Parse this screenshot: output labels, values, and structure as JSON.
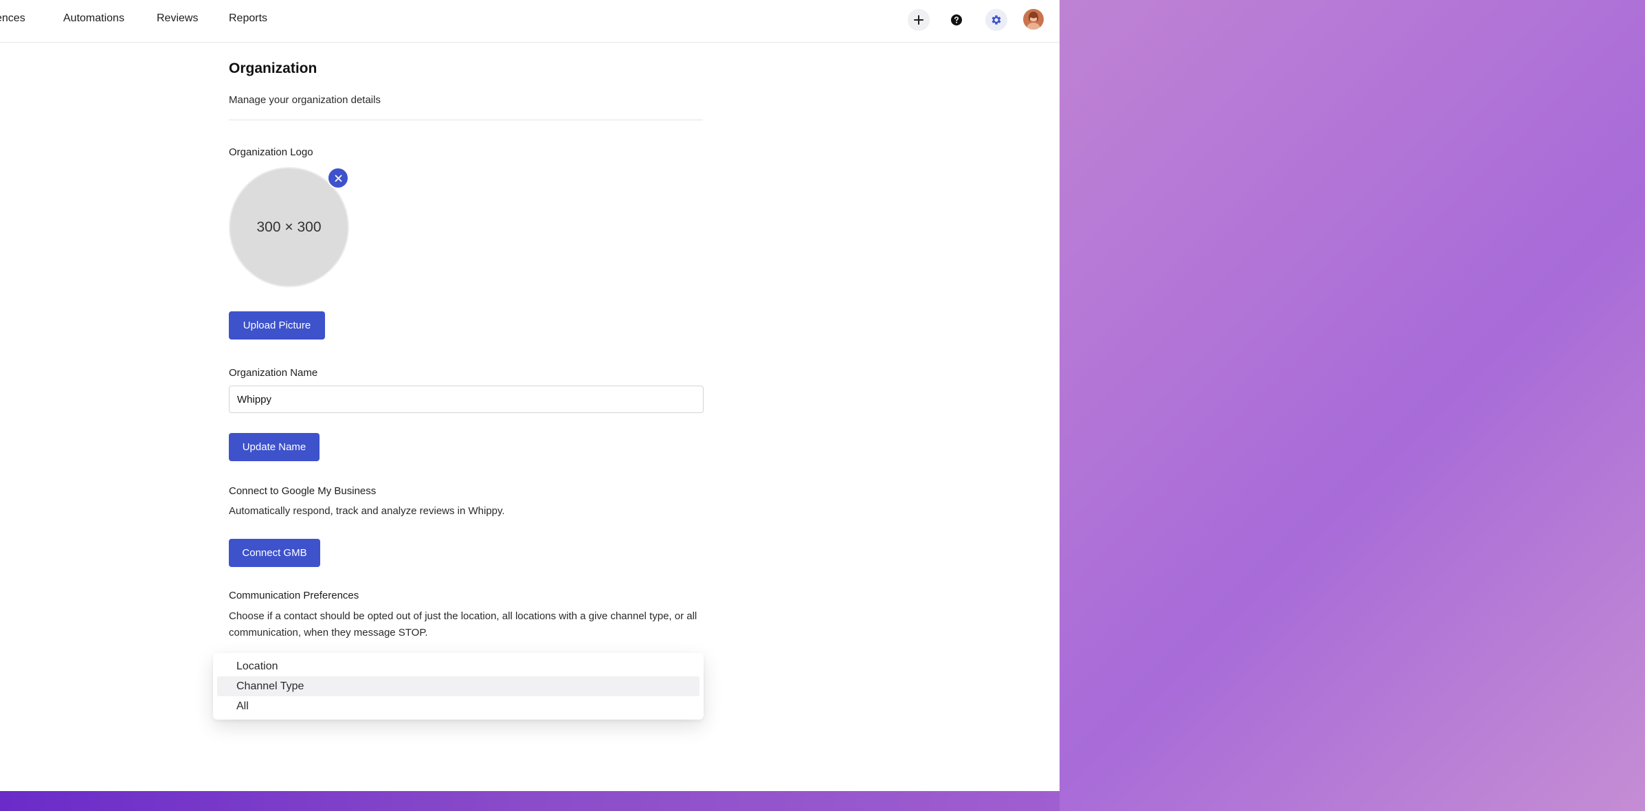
{
  "nav": {
    "items": [
      {
        "label": "ences"
      },
      {
        "label": "Automations"
      },
      {
        "label": "Reviews"
      },
      {
        "label": "Reports"
      }
    ],
    "icons": {
      "add": "plus-icon",
      "help": "help-icon",
      "settings": "gear-icon",
      "avatar": "user-avatar"
    }
  },
  "page": {
    "title": "Organization",
    "subtitle": "Manage your organization details"
  },
  "logo": {
    "label": "Organization Logo",
    "placeholder_text": "300 × 300",
    "upload_label": "Upload Picture"
  },
  "name": {
    "label": "Organization Name",
    "value": "Whippy",
    "update_label": "Update Name"
  },
  "gmb": {
    "label": "Connect to Google My Business",
    "description": "Automatically respond, track and analyze reviews in Whippy.",
    "button_label": "Connect GMB"
  },
  "comm": {
    "label": "Communication Preferences",
    "description": "Choose if a contact should be opted out of just the location, all locations with a give channel type, or all communication, when they message STOP.",
    "options": [
      "Location",
      "Channel Type",
      "All"
    ],
    "highlighted_option": "Channel Type"
  },
  "colors": {
    "accent": "#3e52cc",
    "gradient_start": "#d9a7d6",
    "gradient_end": "#a86bd8"
  }
}
